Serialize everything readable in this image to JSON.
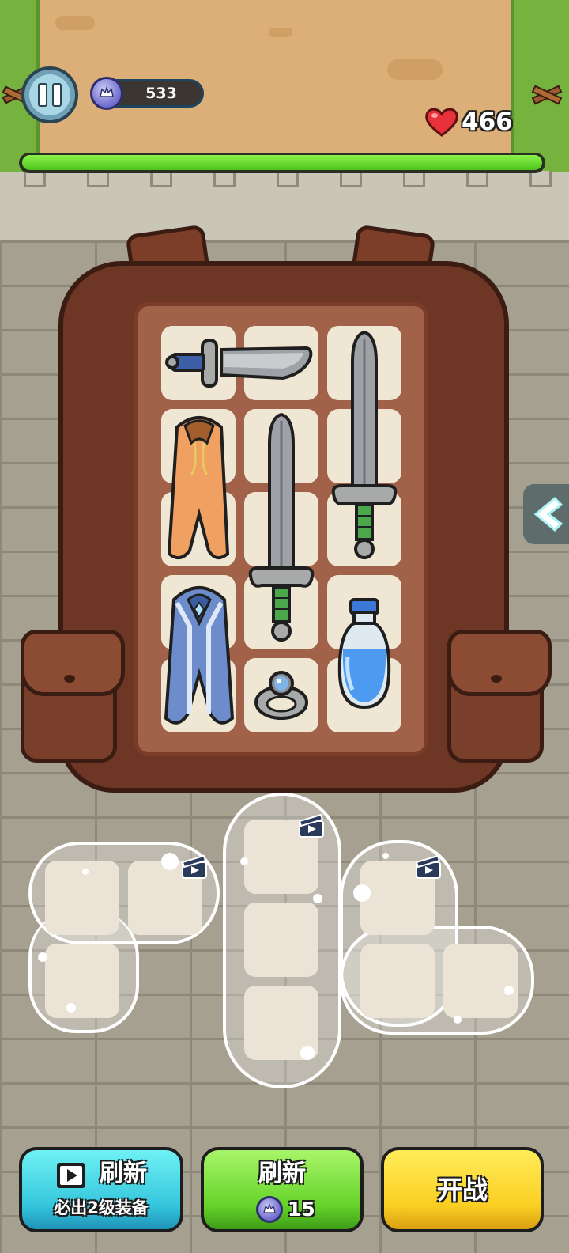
{
  "hud": {
    "gem_count": "533",
    "hp": "466",
    "hp_bar_fraction": 1.0
  },
  "icons": {
    "pause": "pause-icon",
    "gem": "crown-gem-icon",
    "heart": "heart-icon",
    "video": "video-ad-icon",
    "arrow": "chevron-left-icon"
  },
  "backpack": {
    "items": [
      "short-sword",
      "orange-cloak",
      "long-sword",
      "long-sword",
      "blue-cloak",
      "silver-ring",
      "blue-potion"
    ]
  },
  "buttons": {
    "ad_refresh_label": "刷新",
    "ad_refresh_sub": "必出2级装备",
    "refresh_label": "刷新",
    "refresh_cost": "15",
    "fight_label": "开战"
  },
  "colors": {
    "hp_fill": "#4bc41a",
    "ad_button": "#35c6dc",
    "refresh_button": "#66d32a",
    "fight_button": "#fbcf22"
  }
}
